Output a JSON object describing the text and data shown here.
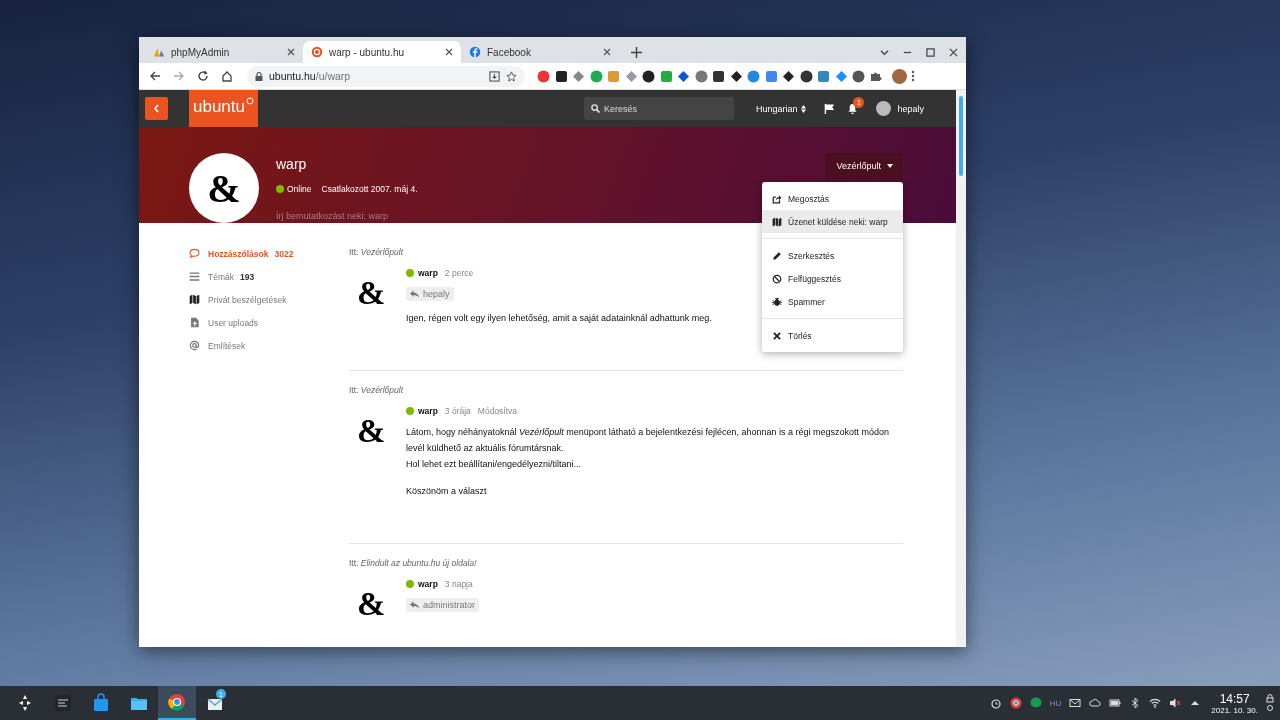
{
  "browser": {
    "tabs": [
      {
        "title": "phpMyAdmin",
        "kind": "sail",
        "selected": false
      },
      {
        "title": "warp - ubuntu.hu",
        "kind": "ubuntu",
        "selected": true
      },
      {
        "title": "Facebook",
        "kind": "facebook",
        "selected": false
      }
    ],
    "address": {
      "host": "ubuntu.hu",
      "path": "/u/warp"
    }
  },
  "site_header": {
    "logo": "ubuntu",
    "search": {
      "placeholder": "Keresés"
    },
    "language": "Hungarian",
    "notification_count": "1",
    "user": "hepaly"
  },
  "profile": {
    "avatar": "&",
    "name": "warp",
    "online": true,
    "status": "Online",
    "joined": "Csatlakozott 2007. máj 4.",
    "about_placeholder": "Írj bemutatkozást neki: warp",
    "menu_button": "Vezérlőpult"
  },
  "dropdown": {
    "items": [
      {
        "kind": "share",
        "label": "Megosztás",
        "selected": false
      },
      {
        "kind": "map",
        "label": "Üzenet küldése neki: warp",
        "selected": true
      },
      {
        "kind": "divider"
      },
      {
        "kind": "pencil",
        "label": "Szerkesztés",
        "selected": false
      },
      {
        "kind": "ban",
        "label": "Felfüggesztés",
        "selected": false
      },
      {
        "kind": "bug",
        "label": "Spammer",
        "selected": false
      },
      {
        "kind": "divider"
      },
      {
        "kind": "times",
        "label": "Törlés",
        "selected": false
      }
    ]
  },
  "sidebar": {
    "items": [
      {
        "kind": "comment",
        "label": "Hozzászólások",
        "count": "3022",
        "selected": true
      },
      {
        "kind": "bars",
        "label": "Témák",
        "count": "193",
        "selected": false
      },
      {
        "kind": "map",
        "label": "Privát beszélgetések",
        "selected": false
      },
      {
        "kind": "upload",
        "label": "User uploads",
        "selected": false
      },
      {
        "kind": "at",
        "label": "Említések",
        "selected": false
      }
    ]
  },
  "posts": [
    {
      "context_label": "Itt:",
      "context": "Vezérlőpult",
      "avatar": "&",
      "author": "warp",
      "online": true,
      "time": "2 perce",
      "reply_to": "hepaly",
      "body": [
        [
          "Igen, régen volt egy ilyen lehetőség, amit a saját adatainknál adhattunk meg."
        ]
      ]
    },
    {
      "context_label": "Itt:",
      "context": "Vezérlőpult",
      "avatar": "&",
      "author": "warp",
      "online": true,
      "time": "3 órája",
      "edited": "Módosítva",
      "body": [
        [
          "Látom, hogy néhányatoknál *Vezérlőpult* menüpont látható a bejelentkezési fejlécen, ahonnan is a régi megszokott módon levél küldhető az aktuális fórumtársnak.",
          "Hol lehet ezt beállítani/engedélyezni/tiltani..."
        ],
        [
          "Köszönöm a választ"
        ]
      ]
    },
    {
      "context_label": "Itt:",
      "context": "Elindult az ubuntu.hu új oldala!",
      "avatar": "&",
      "author": "warp",
      "online": true,
      "time": "3 napja",
      "reply_to": "administrator"
    }
  ],
  "taskbar": {
    "mail_badge": "1",
    "keyboard_layout": "HU",
    "time": "14:57",
    "date": "2021. 10. 30."
  }
}
